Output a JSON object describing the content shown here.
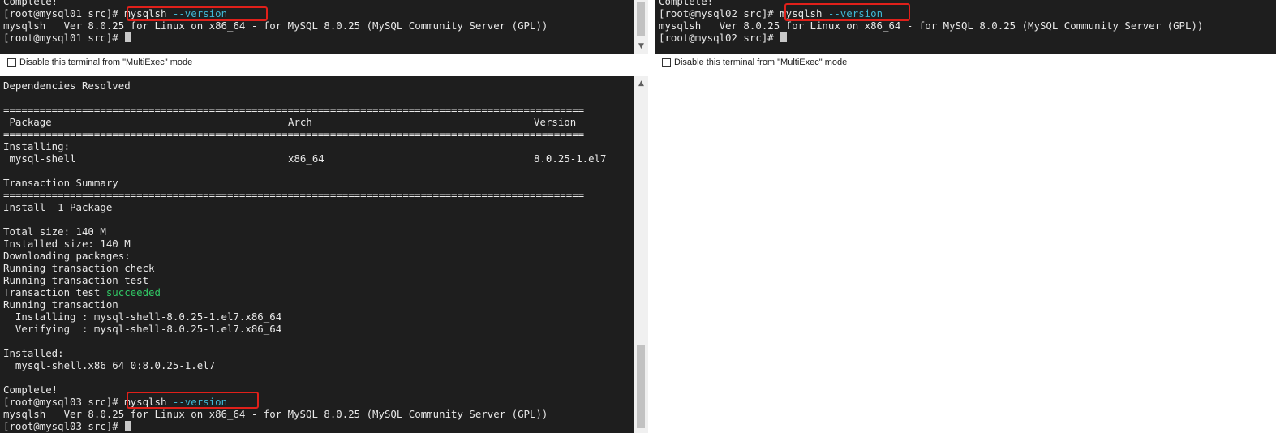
{
  "multiexec_label": "Disable this terminal from \"MultiExec\" mode",
  "t1": {
    "l0": "Complete!",
    "l1_prompt": "[root@mysql01 src]# ",
    "cmd_a": "mysqlsh ",
    "cmd_b": "--version",
    "l2": "mysqlsh   Ver 8.0.25 for Linux on x86_64 - for MySQL 8.0.25 (MySQL Community Server (GPL))",
    "l3_prompt": "[root@mysql01 src]# "
  },
  "t2": {
    "l0": "Complete!",
    "l1_prompt": "[root@mysql02 src]# ",
    "cmd_a": "mysqlsh ",
    "cmd_b": "--version",
    "l2": "mysqlsh   Ver 8.0.25 for Linux on x86_64 - for MySQL 8.0.25 (MySQL Community Server (GPL))",
    "l3_prompt": "[root@mysql02 src]# "
  },
  "t3": {
    "deps": "Dependencies Resolved",
    "sep": "================================================================================================",
    "col_package": "Package",
    "col_arch": "Arch",
    "col_version": "Version",
    "installing": "Installing:",
    "pkg_name": "mysql-shell",
    "pkg_arch": "x86_64",
    "pkg_version": "8.0.25-1.el7",
    "summary": "Transaction Summary",
    "install_count": "Install  1 Package",
    "total_size": "Total size: 140 M",
    "installed_size": "Installed size: 140 M",
    "downloading": "Downloading packages:",
    "running_check": "Running transaction check",
    "running_test": "Running transaction test",
    "test_prefix": "Transaction test ",
    "test_result": "succeeded",
    "running_tx": "Running transaction",
    "installing_line": "  Installing : mysql-shell-8.0.25-1.el7.x86_64",
    "verifying_line": "  Verifying  : mysql-shell-8.0.25-1.el7.x86_64",
    "installed": "Installed:",
    "installed_pkg": "  mysql-shell.x86_64 0:8.0.25-1.el7",
    "complete": "Complete!",
    "prompt": "[root@mysql03 src]# ",
    "cmd_a": "mysqlsh ",
    "cmd_b": "--version",
    "version_line": "mysqlsh   Ver 8.0.25 for Linux on x86_64 - for MySQL 8.0.25 (MySQL Community Server (GPL))",
    "prompt2": "[root@mysql03 src]# "
  },
  "icons": {
    "scroll_up": "scroll-up-arrow",
    "scroll_down": "scroll-down-arrow"
  },
  "colors": {
    "terminal_bg": "#1e1e1e",
    "highlight": "#e0201a",
    "option_text": "#3fb7d4",
    "success": "#31c865"
  }
}
